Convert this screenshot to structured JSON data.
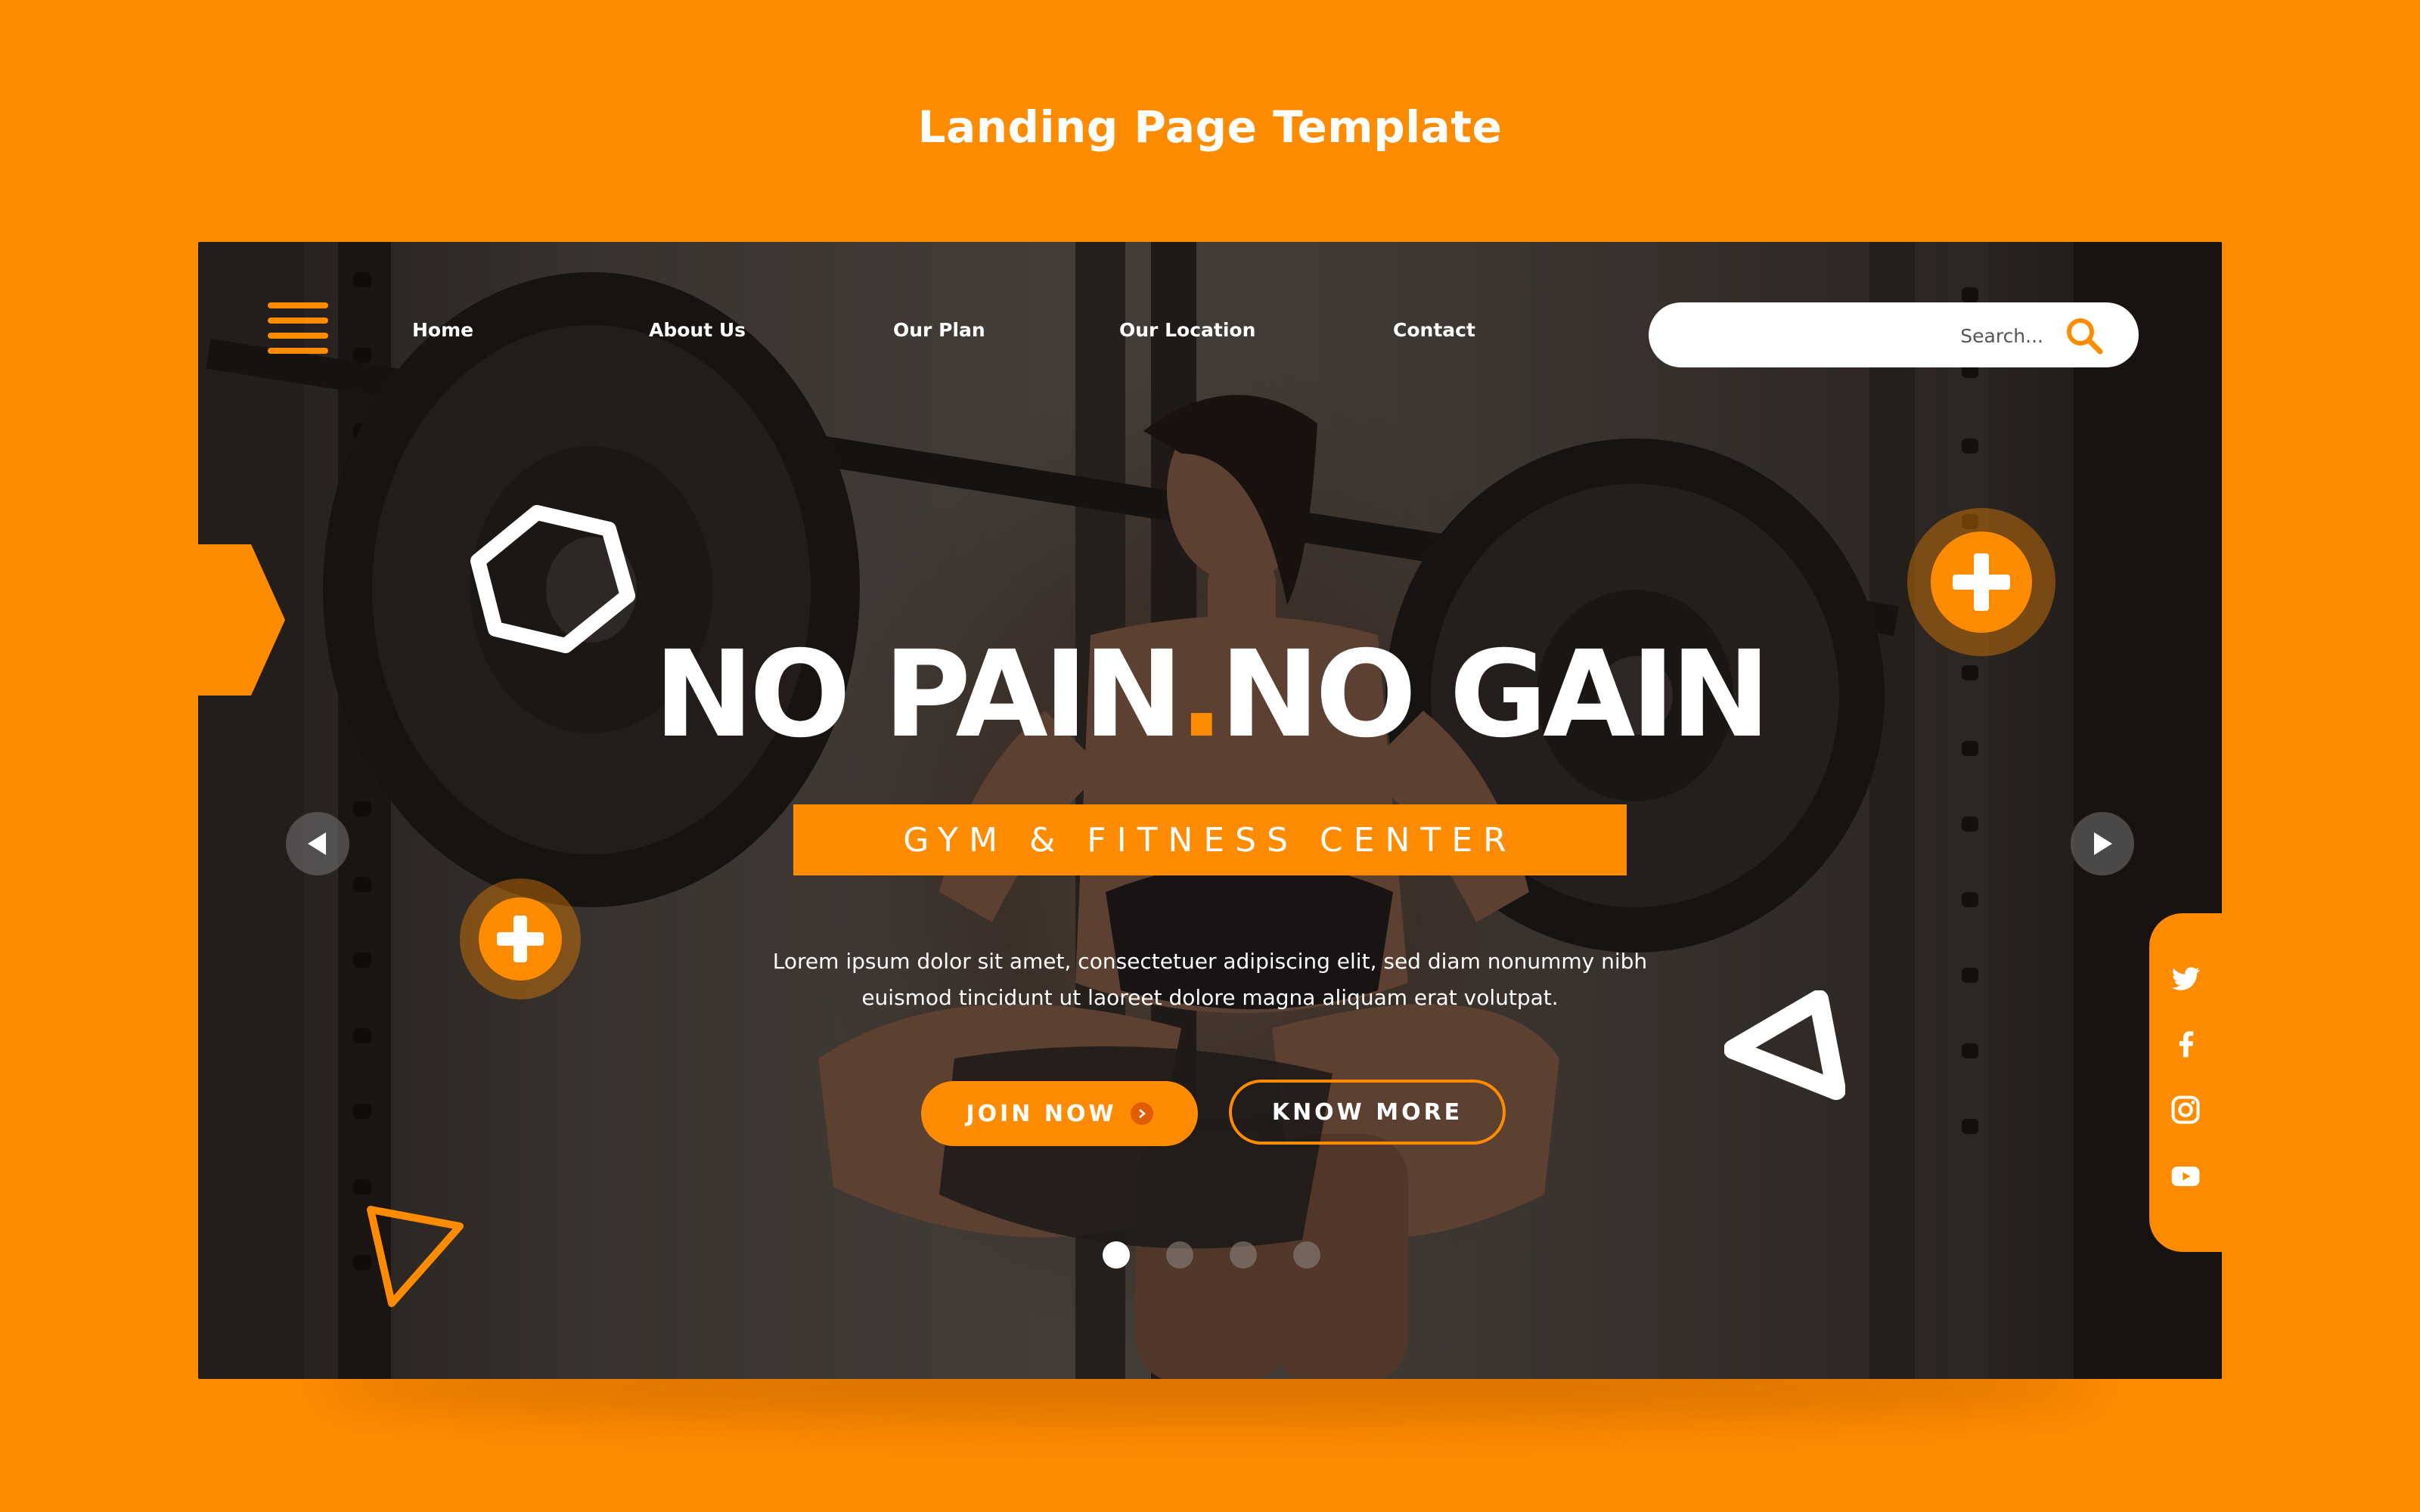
{
  "page": {
    "title": "Landing Page Template"
  },
  "nav": {
    "links": [
      "Home",
      "About Us",
      "Our Plan",
      "Our Location",
      "Contact"
    ]
  },
  "search": {
    "placeholder": "Search..."
  },
  "hero": {
    "headline_part1": "NO PAIN",
    "headline_dot": ".",
    "headline_part2": "NO GAIN",
    "subtitle": "GYM & FITNESS CENTER",
    "description_line1": "Lorem ipsum dolor sit amet, consectetuer adipiscing elit, sed diam nonummy nibh",
    "description_line2": "euismod tincidunt ut laoreet dolore magna aliquam erat volutpat.",
    "join_button": "JOIN NOW",
    "know_button": "KNOW MORE",
    "slide_count": 4,
    "active_slide": 1
  },
  "social": [
    "twitter-icon",
    "facebook-icon",
    "instagram-icon",
    "youtube-icon"
  ],
  "colors": {
    "accent": "#ff8c00",
    "white": "#ffffff"
  }
}
